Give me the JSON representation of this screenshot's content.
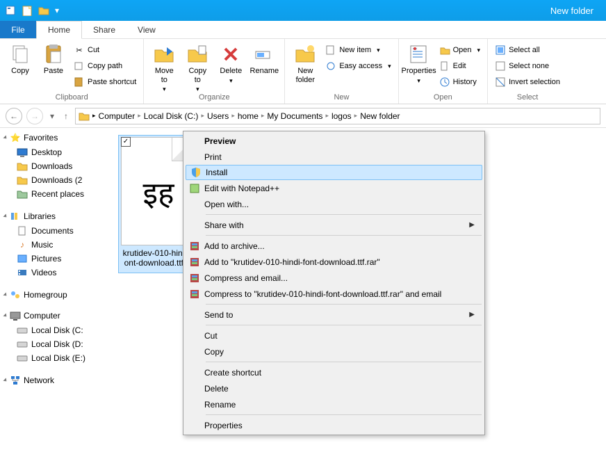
{
  "window": {
    "title": "New folder"
  },
  "tabs": {
    "file": "File",
    "home": "Home",
    "share": "Share",
    "view": "View"
  },
  "ribbon": {
    "clipboard": {
      "label": "Clipboard",
      "copy": "Copy",
      "paste": "Paste",
      "cut": "Cut",
      "copypath": "Copy path",
      "pasteshortcut": "Paste shortcut"
    },
    "organize": {
      "label": "Organize",
      "moveto": "Move\nto",
      "copyto": "Copy\nto",
      "delete": "Delete",
      "rename": "Rename"
    },
    "new": {
      "label": "New",
      "newfolder": "New\nfolder",
      "newitem": "New item",
      "easyaccess": "Easy access"
    },
    "open": {
      "label": "Open",
      "properties": "Properties",
      "open": "Open",
      "edit": "Edit",
      "history": "History"
    },
    "select": {
      "label": "Select",
      "selectall": "Select all",
      "selectnone": "Select none",
      "invert": "Invert selection"
    }
  },
  "breadcrumbs": [
    "Computer",
    "Local Disk (C:)",
    "Users",
    "home",
    "My Documents",
    "logos",
    "New folder"
  ],
  "sidebar": {
    "favorites": {
      "label": "Favorites",
      "items": [
        "Desktop",
        "Downloads",
        "Downloads (2",
        "Recent places"
      ]
    },
    "libraries": {
      "label": "Libraries",
      "items": [
        "Documents",
        "Music",
        "Pictures",
        "Videos"
      ]
    },
    "homegroup": {
      "label": "Homegroup"
    },
    "computer": {
      "label": "Computer",
      "items": [
        "Local Disk (C:",
        "Local Disk (D:",
        "Local Disk (E:)"
      ]
    },
    "network": {
      "label": "Network"
    }
  },
  "file": {
    "name": "krutidev-010-hindi-font-download.ttf.ttf",
    "glyph": "इह"
  },
  "context": {
    "preview": "Preview",
    "print": "Print",
    "install": "Install",
    "editnpp": "Edit with Notepad++",
    "openwith": "Open with...",
    "sharewith": "Share with",
    "addarchive": "Add to archive...",
    "addrar": "Add to \"krutidev-010-hindi-font-download.ttf.rar\"",
    "compressemail": "Compress and email...",
    "compressto": "Compress to \"krutidev-010-hindi-font-download.ttf.rar\" and email",
    "sendto": "Send to",
    "cut": "Cut",
    "copy": "Copy",
    "createshortcut": "Create shortcut",
    "delete": "Delete",
    "rename": "Rename",
    "properties": "Properties"
  }
}
